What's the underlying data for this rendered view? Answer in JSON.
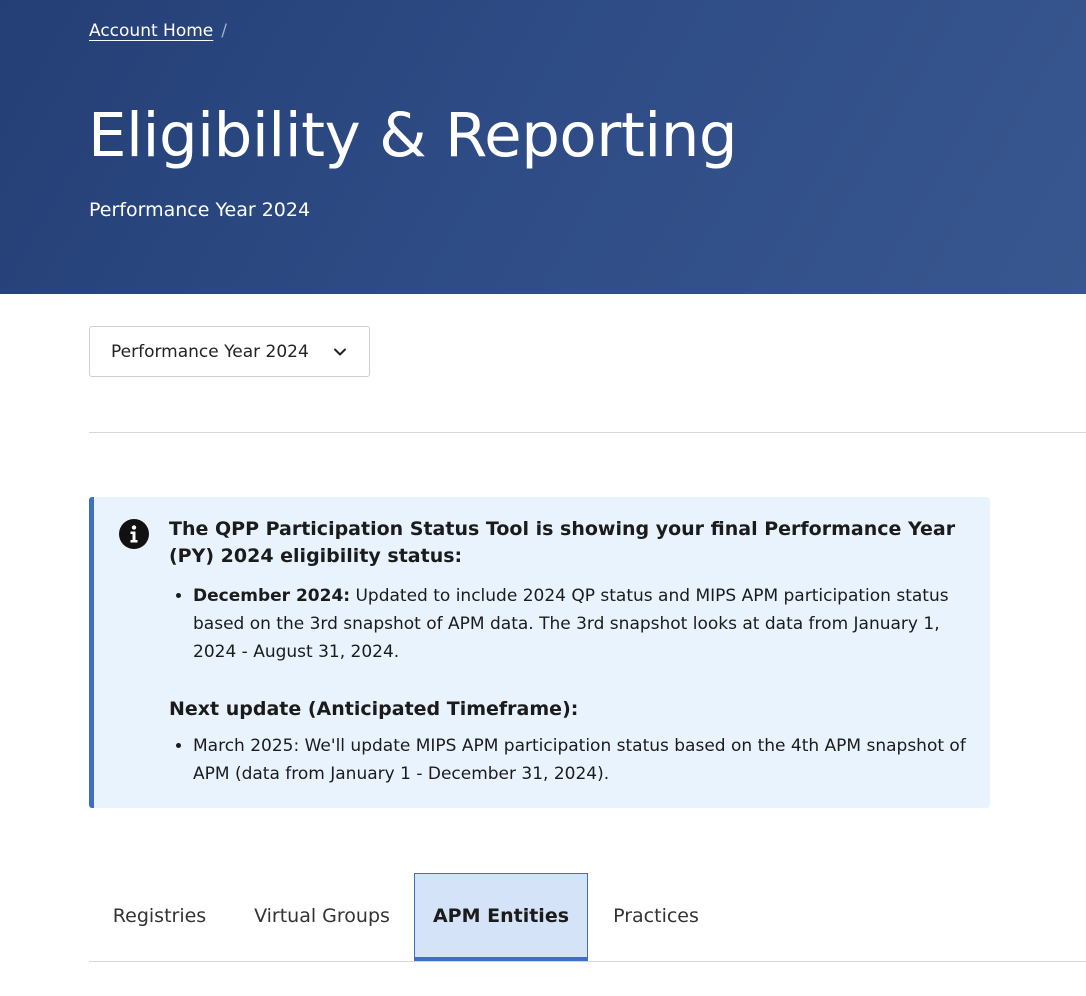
{
  "breadcrumb": {
    "home_label": "Account Home",
    "separator": "/"
  },
  "header": {
    "title": "Eligibility & Reporting",
    "subtitle": "Performance Year 2024"
  },
  "year_select": {
    "selected": "Performance Year 2024",
    "icon": "chevron-down-icon"
  },
  "alert": {
    "icon": "info-icon",
    "heading": "The QPP Participation Status Tool is showing your final Performance Year (PY) 2024 eligibility status:",
    "items": [
      {
        "bold": "December 2024:",
        "text": " Updated to include 2024 QP status and MIPS APM participation status based on the 3rd snapshot of APM data. The 3rd snapshot looks at data from January 1, 2024 - August 31, 2024."
      }
    ],
    "next_heading": "Next update (Anticipated Timeframe):",
    "next_items": [
      {
        "text": "March 2025: We'll update MIPS APM participation status based on the 4th APM snapshot of APM (data from January 1 - December 31, 2024)."
      }
    ]
  },
  "tabs": [
    {
      "label": "Registries",
      "active": false
    },
    {
      "label": "Virtual Groups",
      "active": false
    },
    {
      "label": "APM Entities",
      "active": true
    },
    {
      "label": "Practices",
      "active": false
    }
  ],
  "colors": {
    "header_bg": "#2e4b85",
    "alert_bg": "#e8f3fd",
    "alert_border": "#3f6fc0",
    "active_tab_bg": "#d4e3f8"
  }
}
